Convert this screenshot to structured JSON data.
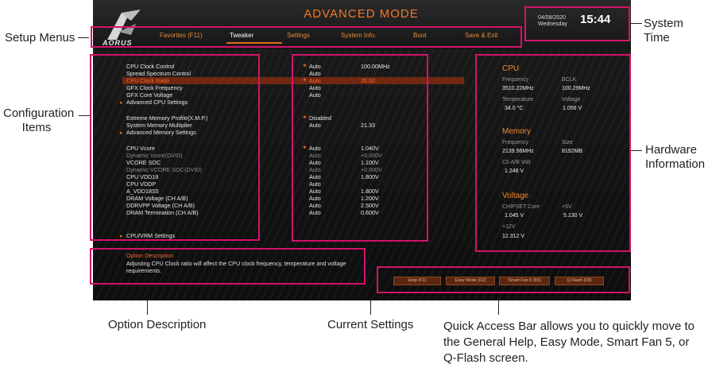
{
  "annotations": {
    "setup_menus": "Setup Menus",
    "configuration_items": "Configuration Items",
    "option_description": "Option Description",
    "current_settings": "Current Settings",
    "quick_access": "Quick Access Bar allows you to quickly move to the General Help, Easy Mode, Smart Fan 5, or Q-Flash screen.",
    "system_time": "System Time",
    "hardware_info": "Hardware Information"
  },
  "header": {
    "mode_title": "ADVANCED MODE",
    "logo_text": "AORUS",
    "date_line1": "04/08/2020",
    "date_line2": "Wednesday",
    "time": "15:44"
  },
  "tabs": [
    "Favorites (F11)",
    "Tweaker",
    "Settings",
    "System Info.",
    "Boot",
    "Save & Exit"
  ],
  "active_tab": "Tweaker",
  "config_items": [
    {
      "label": "CPU Clock Control",
      "value": "Auto",
      "value2": "100.00MHz",
      "star": true,
      "state": "normal"
    },
    {
      "label": "Spread Spectrum Control",
      "value": "Auto",
      "value2": "",
      "star": false,
      "state": "normal"
    },
    {
      "label": "CPU Clock Ratio",
      "value": "Auto",
      "value2": "35.00",
      "star": true,
      "state": "highlight"
    },
    {
      "label": "GFX Clock Frequency",
      "value": "Auto",
      "value2": "",
      "star": false,
      "state": "normal"
    },
    {
      "label": "GFX Core Voltage",
      "value": "Auto",
      "value2": "",
      "star": false,
      "state": "normal"
    },
    {
      "label": "Advanced CPU Settings",
      "value": "",
      "value2": "",
      "star": false,
      "state": "submenu"
    },
    {
      "label": "Extreme Memory Profile(X.M.P.)",
      "value": "Disabled",
      "value2": "",
      "star": true,
      "state": "normal"
    },
    {
      "label": "System Memory Multiplier",
      "value": "Auto",
      "value2": "21.33",
      "star": false,
      "state": "normal"
    },
    {
      "label": "Advanced Memory Settings",
      "value": "",
      "value2": "",
      "star": false,
      "state": "submenu"
    },
    {
      "label": "CPU Vcore",
      "value": "Auto",
      "value2": "1.040V",
      "star": true,
      "state": "normal"
    },
    {
      "label": "Dynamic Vcore(DVID)",
      "value": "Auto",
      "value2": "+0.000V",
      "star": false,
      "state": "dim"
    },
    {
      "label": "VCORE SOC",
      "value": "Auto",
      "value2": "1.100V",
      "star": false,
      "state": "normal"
    },
    {
      "label": "Dynamic VCORE SOC(DVID)",
      "value": "Auto",
      "value2": "+0.000V",
      "star": false,
      "state": "dim"
    },
    {
      "label": "CPU VDD18",
      "value": "Auto",
      "value2": "1.800V",
      "star": false,
      "state": "normal"
    },
    {
      "label": "CPU VDDP",
      "value": "Auto",
      "value2": "",
      "star": false,
      "state": "normal"
    },
    {
      "label": "A_VDD18S5",
      "value": "Auto",
      "value2": "1.800V",
      "star": false,
      "state": "normal"
    },
    {
      "label": "DRAM Voltage    (CH A/B)",
      "value": "Auto",
      "value2": "1.200V",
      "star": false,
      "state": "normal"
    },
    {
      "label": "DDRVPP Voltage   (CH A/B)",
      "value": "Auto",
      "value2": "2.500V",
      "star": false,
      "state": "normal"
    },
    {
      "label": "DRAM Termination  (CH A/B)",
      "value": "Auto",
      "value2": "0.600V",
      "star": false,
      "state": "normal"
    },
    {
      "label": "CPU/VRM Settings",
      "value": "",
      "value2": "",
      "star": false,
      "state": "submenu"
    }
  ],
  "hardware": {
    "cpu": {
      "title": "CPU",
      "freq_label": "Frequency",
      "freq": "3510.22MHz",
      "bclk_label": "BCLK",
      "bclk": "100.29MHz",
      "temp_label": "Temperature",
      "temp": "34.0 °C",
      "volt_label": "Voltage",
      "volt": "1.056 V"
    },
    "memory": {
      "title": "Memory",
      "freq_label": "Frequency",
      "freq": "2139.56MHz",
      "size_label": "Size",
      "size": "8192MB",
      "chvolt_label": "Ch A/B Volt",
      "chvolt": "1.248 V"
    },
    "voltage": {
      "title": "Voltage",
      "chipset_label": "CHIPSET Core",
      "chipset": "1.045 V",
      "p5_label": "+5V",
      "p5": "5.130 V",
      "p12_label": "+12V",
      "p12": "12.312 V"
    }
  },
  "option_description": {
    "title": "Option Description",
    "text": "Adjusting CPU Clock ratio will affect the CPU clock frequency, temperature and voltage requirements."
  },
  "quick_access": [
    "Help (F1)",
    "Easy Mode (F2)",
    "Smart Fan 5 (F6)",
    "Q-Flash (F8)"
  ],
  "colors": {
    "accent": "#e36d1c",
    "frame": "#d4136a",
    "highlight_bar": "#7a2a12"
  }
}
